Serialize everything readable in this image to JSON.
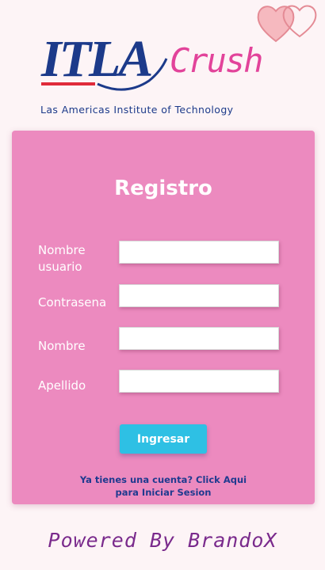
{
  "header": {
    "logo_main": "ITLA",
    "logo_suffix": "Crush",
    "institute": "Las Americas Institute of Technology"
  },
  "form": {
    "title": "Registro",
    "fields": [
      {
        "label": "Nombre usuario",
        "value": "",
        "placeholder": ""
      },
      {
        "label": "Contrasena",
        "value": "",
        "placeholder": ""
      },
      {
        "label": "Nombre",
        "value": "",
        "placeholder": ""
      },
      {
        "label": "Apellido",
        "value": "",
        "placeholder": ""
      }
    ],
    "submit_label": "Ingresar",
    "login_link_line1": "Ya tienes una cuenta? Click Aqui",
    "login_link_line2": "para Iniciar Sesion"
  },
  "footer": {
    "powered_by": "Powered By BrandoX"
  },
  "colors": {
    "card": "#ec8abf",
    "button": "#2ec0e4",
    "logo_blue": "#1c3a8a",
    "crush_pink": "#e2439a",
    "footer_purple": "#7a2a8c"
  },
  "icons": {
    "hearts": "hearts-icon"
  }
}
